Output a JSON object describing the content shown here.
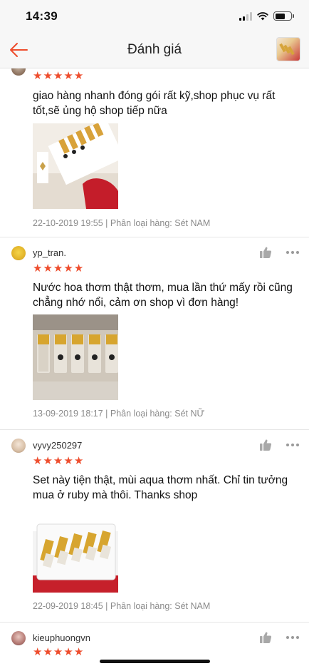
{
  "status_bar": {
    "time": "14:39"
  },
  "nav": {
    "title": "Đánh giá"
  },
  "colors": {
    "star": "#ee4d2d",
    "back_arrow": "#ee4d2d",
    "meta_text": "#8a8a8a"
  },
  "reviews": [
    {
      "username": "",
      "rating": 5,
      "text": "giao hàng nhanh đóng gói rất kỹ,shop phục vụ rất tốt,sẽ ủng hộ shop tiếp nữa",
      "meta": "22-10-2019 19:55 | Phân loại hàng: Sét NAM"
    },
    {
      "username": "yp_tran.",
      "rating": 5,
      "text": "Nước hoa thơm thật thơm, mua lần thứ mấy rồi cũng chẳng nhớ nổi, cảm ơn shop vì đơn hàng!",
      "meta": "13-09-2019 18:17 | Phân loại hàng: Sét NỮ"
    },
    {
      "username": "vyvy250297",
      "rating": 5,
      "text": "Set này tiện thật,  mùi aqua thơm nhất.  Chỉ tin tưởng mua ở ruby mà thôi.  Thanks shop",
      "meta": "22-09-2019 18:45 | Phân loại hàng: Sét NAM"
    },
    {
      "username": "kieuphuongvn",
      "rating": 5,
      "text": "",
      "meta": ""
    }
  ]
}
